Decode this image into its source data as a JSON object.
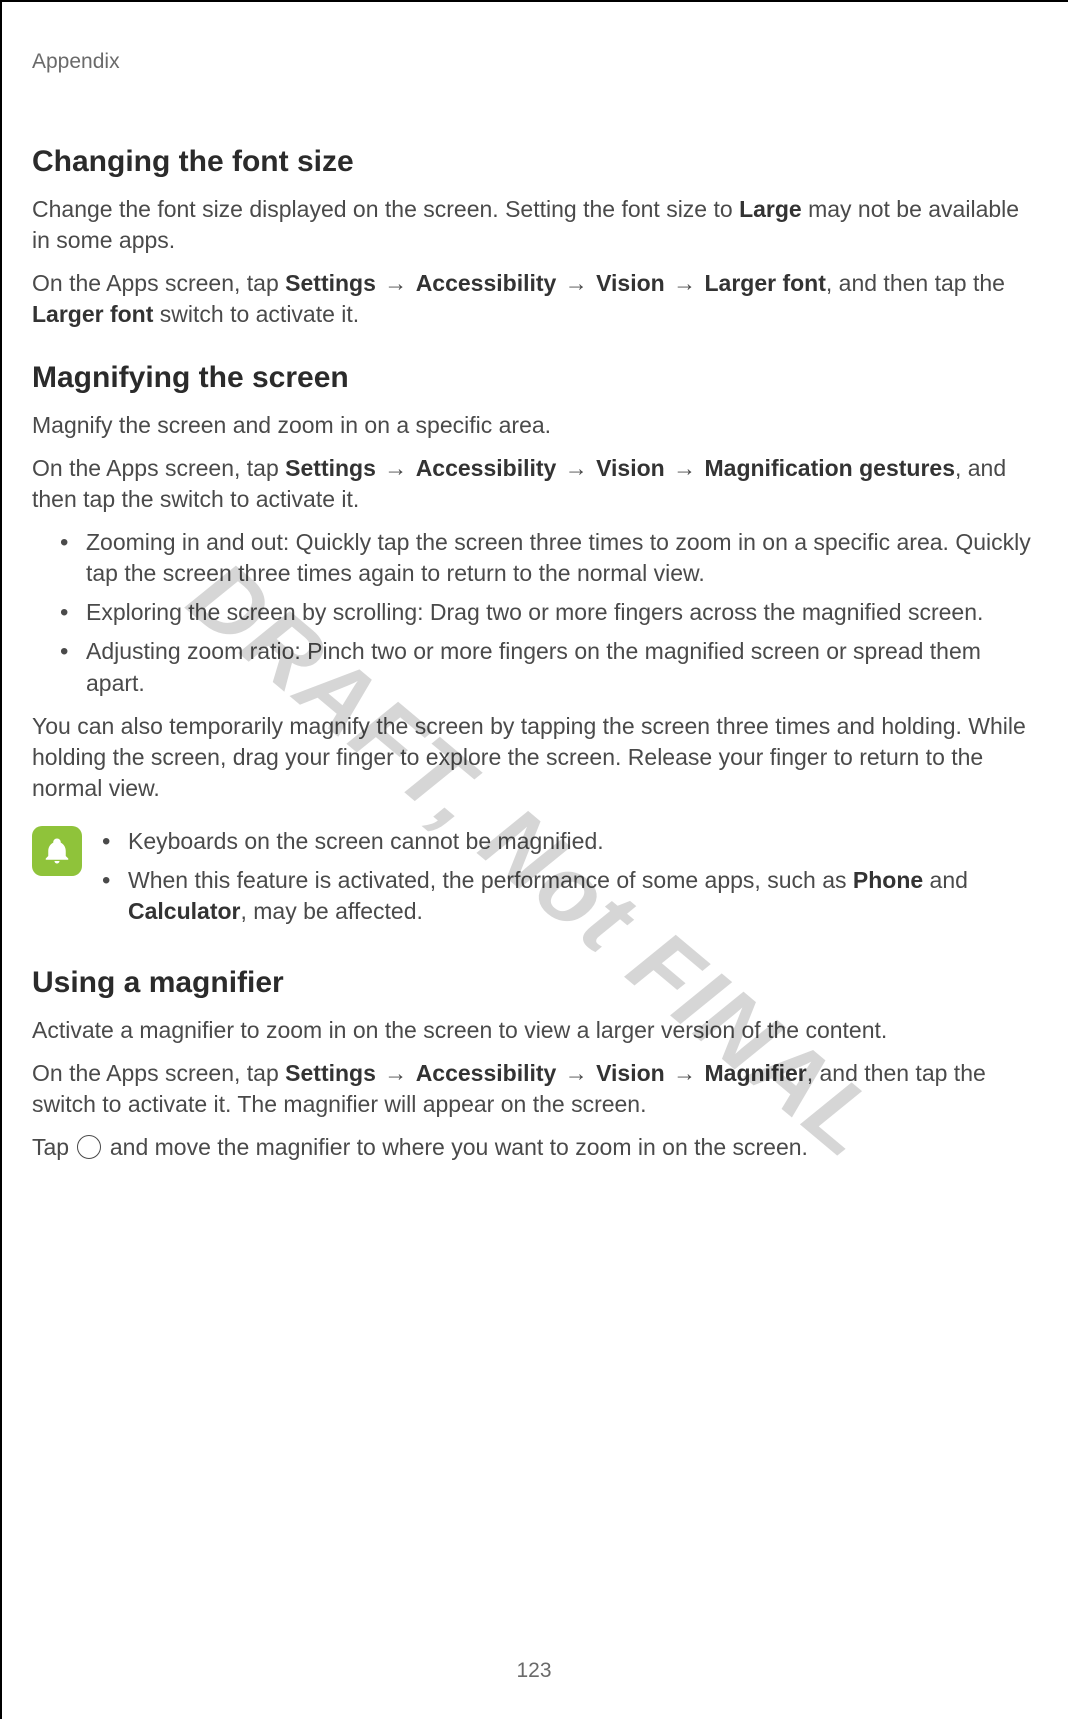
{
  "header": {
    "running_head": "Appendix"
  },
  "watermark": "DRAFT, Not FINAL",
  "page_number": "123",
  "glyphs": {
    "arrow": "→"
  },
  "s1": {
    "title": "Changing the font size",
    "p1_a": "Change the font size displayed on the screen. Setting the font size to ",
    "p1_b": "Large",
    "p1_c": " may not be available in some apps.",
    "p2_a": "On the Apps screen, tap ",
    "p2_settings": "Settings",
    "p2_accessibility": "Accessibility",
    "p2_vision": "Vision",
    "p2_larger_font": "Larger font",
    "p2_b": ", and then tap the ",
    "p2_larger_font2": "Larger font",
    "p2_c": " switch to activate it."
  },
  "s2": {
    "title": "Magnifying the screen",
    "p1": "Magnify the screen and zoom in on a specific area.",
    "p2_a": "On the Apps screen, tap ",
    "p2_settings": "Settings",
    "p2_accessibility": "Accessibility",
    "p2_vision": "Vision",
    "p2_mag": "Magnification gestures",
    "p2_b": ", and then tap the switch to activate it.",
    "bullets": {
      "b1": "Zooming in and out: Quickly tap the screen three times to zoom in on a specific area. Quickly tap the screen three times again to return to the normal view.",
      "b2": "Exploring the screen by scrolling: Drag two or more fingers across the magnified screen.",
      "b3": "Adjusting zoom ratio: Pinch two or more fingers on the magnified screen or spread them apart."
    },
    "p3": "You can also temporarily magnify the screen by tapping the screen three times and holding. While holding the screen, drag your finger to explore the screen. Release your finger to return to the normal view.",
    "note": {
      "n1": "Keyboards on the screen cannot be magnified.",
      "n2_a": "When this feature is activated, the performance of some apps, such as ",
      "n2_phone": "Phone",
      "n2_and": " and ",
      "n2_calc": "Calculator",
      "n2_b": ", may be affected."
    }
  },
  "s3": {
    "title": "Using a magnifier",
    "p1": "Activate a magnifier to zoom in on the screen to view a larger version of the content.",
    "p2_a": "On the Apps screen, tap ",
    "p2_settings": "Settings",
    "p2_accessibility": "Accessibility",
    "p2_vision": "Vision",
    "p2_magnifier": "Magnifier",
    "p2_b": ", and then tap the switch to activate it. The magnifier will appear on the screen.",
    "p3_a": "Tap ",
    "p3_b": " and move the magnifier to where you want to zoom in on the screen."
  }
}
